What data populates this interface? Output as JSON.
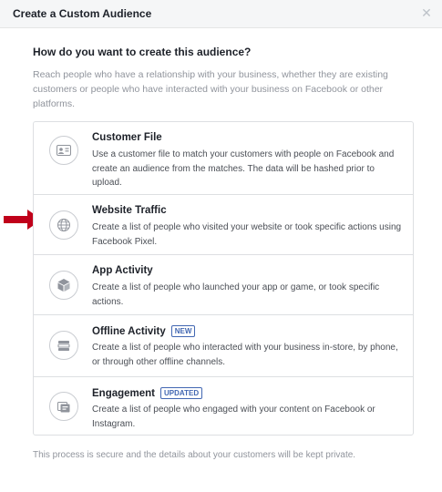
{
  "dialog": {
    "title": "Create a Custom Audience",
    "close_icon": "close-icon",
    "question": "How do you want to create this audience?",
    "intro": "Reach people who have a relationship with your business, whether they are existing customers or people who have interacted with your business on Facebook or other platforms.",
    "options": [
      {
        "title": "Customer File",
        "badge": "",
        "icon": "contact-card-icon",
        "description": "Use a customer file to match your customers with people on Facebook and create an audience from the matches. The data will be hashed prior to upload."
      },
      {
        "title": "Website Traffic",
        "badge": "",
        "icon": "globe-icon",
        "description": "Create a list of people who visited your website or took specific actions using Facebook Pixel."
      },
      {
        "title": "App Activity",
        "badge": "",
        "icon": "app-cube-icon",
        "description": "Create a list of people who launched your app or game, or took specific actions."
      },
      {
        "title": "Offline Activity",
        "badge": "NEW",
        "icon": "offline-store-icon",
        "description": "Create a list of people who interacted with your business in-store, by phone, or through other offline channels."
      },
      {
        "title": "Engagement",
        "badge": "UPDATED",
        "icon": "engagement-icon",
        "description": "Create a list of people who engaged with your content on Facebook or Instagram."
      }
    ],
    "footer": "This process is secure and the details about your customers will be kept private."
  },
  "colors": {
    "header_bg": "#f5f6f7",
    "border": "#dddfe2",
    "muted_text": "#90949c",
    "badge_blue": "#4267b2",
    "arrow_red": "#c0001a"
  }
}
